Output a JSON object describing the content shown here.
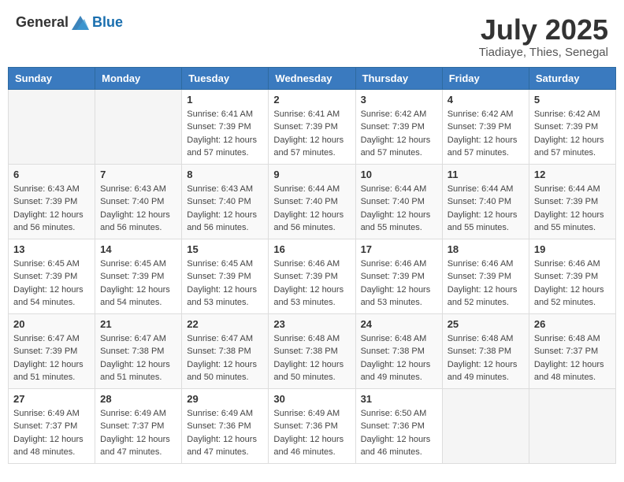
{
  "header": {
    "logo_general": "General",
    "logo_blue": "Blue",
    "month": "July 2025",
    "location": "Tiadiaye, Thies, Senegal"
  },
  "days_of_week": [
    "Sunday",
    "Monday",
    "Tuesday",
    "Wednesday",
    "Thursday",
    "Friday",
    "Saturday"
  ],
  "weeks": [
    [
      {
        "day": "",
        "info": ""
      },
      {
        "day": "",
        "info": ""
      },
      {
        "day": "1",
        "sunrise": "Sunrise: 6:41 AM",
        "sunset": "Sunset: 7:39 PM",
        "daylight": "Daylight: 12 hours and 57 minutes."
      },
      {
        "day": "2",
        "sunrise": "Sunrise: 6:41 AM",
        "sunset": "Sunset: 7:39 PM",
        "daylight": "Daylight: 12 hours and 57 minutes."
      },
      {
        "day": "3",
        "sunrise": "Sunrise: 6:42 AM",
        "sunset": "Sunset: 7:39 PM",
        "daylight": "Daylight: 12 hours and 57 minutes."
      },
      {
        "day": "4",
        "sunrise": "Sunrise: 6:42 AM",
        "sunset": "Sunset: 7:39 PM",
        "daylight": "Daylight: 12 hours and 57 minutes."
      },
      {
        "day": "5",
        "sunrise": "Sunrise: 6:42 AM",
        "sunset": "Sunset: 7:39 PM",
        "daylight": "Daylight: 12 hours and 57 minutes."
      }
    ],
    [
      {
        "day": "6",
        "sunrise": "Sunrise: 6:43 AM",
        "sunset": "Sunset: 7:39 PM",
        "daylight": "Daylight: 12 hours and 56 minutes."
      },
      {
        "day": "7",
        "sunrise": "Sunrise: 6:43 AM",
        "sunset": "Sunset: 7:40 PM",
        "daylight": "Daylight: 12 hours and 56 minutes."
      },
      {
        "day": "8",
        "sunrise": "Sunrise: 6:43 AM",
        "sunset": "Sunset: 7:40 PM",
        "daylight": "Daylight: 12 hours and 56 minutes."
      },
      {
        "day": "9",
        "sunrise": "Sunrise: 6:44 AM",
        "sunset": "Sunset: 7:40 PM",
        "daylight": "Daylight: 12 hours and 56 minutes."
      },
      {
        "day": "10",
        "sunrise": "Sunrise: 6:44 AM",
        "sunset": "Sunset: 7:40 PM",
        "daylight": "Daylight: 12 hours and 55 minutes."
      },
      {
        "day": "11",
        "sunrise": "Sunrise: 6:44 AM",
        "sunset": "Sunset: 7:40 PM",
        "daylight": "Daylight: 12 hours and 55 minutes."
      },
      {
        "day": "12",
        "sunrise": "Sunrise: 6:44 AM",
        "sunset": "Sunset: 7:39 PM",
        "daylight": "Daylight: 12 hours and 55 minutes."
      }
    ],
    [
      {
        "day": "13",
        "sunrise": "Sunrise: 6:45 AM",
        "sunset": "Sunset: 7:39 PM",
        "daylight": "Daylight: 12 hours and 54 minutes."
      },
      {
        "day": "14",
        "sunrise": "Sunrise: 6:45 AM",
        "sunset": "Sunset: 7:39 PM",
        "daylight": "Daylight: 12 hours and 54 minutes."
      },
      {
        "day": "15",
        "sunrise": "Sunrise: 6:45 AM",
        "sunset": "Sunset: 7:39 PM",
        "daylight": "Daylight: 12 hours and 53 minutes."
      },
      {
        "day": "16",
        "sunrise": "Sunrise: 6:46 AM",
        "sunset": "Sunset: 7:39 PM",
        "daylight": "Daylight: 12 hours and 53 minutes."
      },
      {
        "day": "17",
        "sunrise": "Sunrise: 6:46 AM",
        "sunset": "Sunset: 7:39 PM",
        "daylight": "Daylight: 12 hours and 53 minutes."
      },
      {
        "day": "18",
        "sunrise": "Sunrise: 6:46 AM",
        "sunset": "Sunset: 7:39 PM",
        "daylight": "Daylight: 12 hours and 52 minutes."
      },
      {
        "day": "19",
        "sunrise": "Sunrise: 6:46 AM",
        "sunset": "Sunset: 7:39 PM",
        "daylight": "Daylight: 12 hours and 52 minutes."
      }
    ],
    [
      {
        "day": "20",
        "sunrise": "Sunrise: 6:47 AM",
        "sunset": "Sunset: 7:39 PM",
        "daylight": "Daylight: 12 hours and 51 minutes."
      },
      {
        "day": "21",
        "sunrise": "Sunrise: 6:47 AM",
        "sunset": "Sunset: 7:38 PM",
        "daylight": "Daylight: 12 hours and 51 minutes."
      },
      {
        "day": "22",
        "sunrise": "Sunrise: 6:47 AM",
        "sunset": "Sunset: 7:38 PM",
        "daylight": "Daylight: 12 hours and 50 minutes."
      },
      {
        "day": "23",
        "sunrise": "Sunrise: 6:48 AM",
        "sunset": "Sunset: 7:38 PM",
        "daylight": "Daylight: 12 hours and 50 minutes."
      },
      {
        "day": "24",
        "sunrise": "Sunrise: 6:48 AM",
        "sunset": "Sunset: 7:38 PM",
        "daylight": "Daylight: 12 hours and 49 minutes."
      },
      {
        "day": "25",
        "sunrise": "Sunrise: 6:48 AM",
        "sunset": "Sunset: 7:38 PM",
        "daylight": "Daylight: 12 hours and 49 minutes."
      },
      {
        "day": "26",
        "sunrise": "Sunrise: 6:48 AM",
        "sunset": "Sunset: 7:37 PM",
        "daylight": "Daylight: 12 hours and 48 minutes."
      }
    ],
    [
      {
        "day": "27",
        "sunrise": "Sunrise: 6:49 AM",
        "sunset": "Sunset: 7:37 PM",
        "daylight": "Daylight: 12 hours and 48 minutes."
      },
      {
        "day": "28",
        "sunrise": "Sunrise: 6:49 AM",
        "sunset": "Sunset: 7:37 PM",
        "daylight": "Daylight: 12 hours and 47 minutes."
      },
      {
        "day": "29",
        "sunrise": "Sunrise: 6:49 AM",
        "sunset": "Sunset: 7:36 PM",
        "daylight": "Daylight: 12 hours and 47 minutes."
      },
      {
        "day": "30",
        "sunrise": "Sunrise: 6:49 AM",
        "sunset": "Sunset: 7:36 PM",
        "daylight": "Daylight: 12 hours and 46 minutes."
      },
      {
        "day": "31",
        "sunrise": "Sunrise: 6:50 AM",
        "sunset": "Sunset: 7:36 PM",
        "daylight": "Daylight: 12 hours and 46 minutes."
      },
      {
        "day": "",
        "info": ""
      },
      {
        "day": "",
        "info": ""
      }
    ]
  ]
}
